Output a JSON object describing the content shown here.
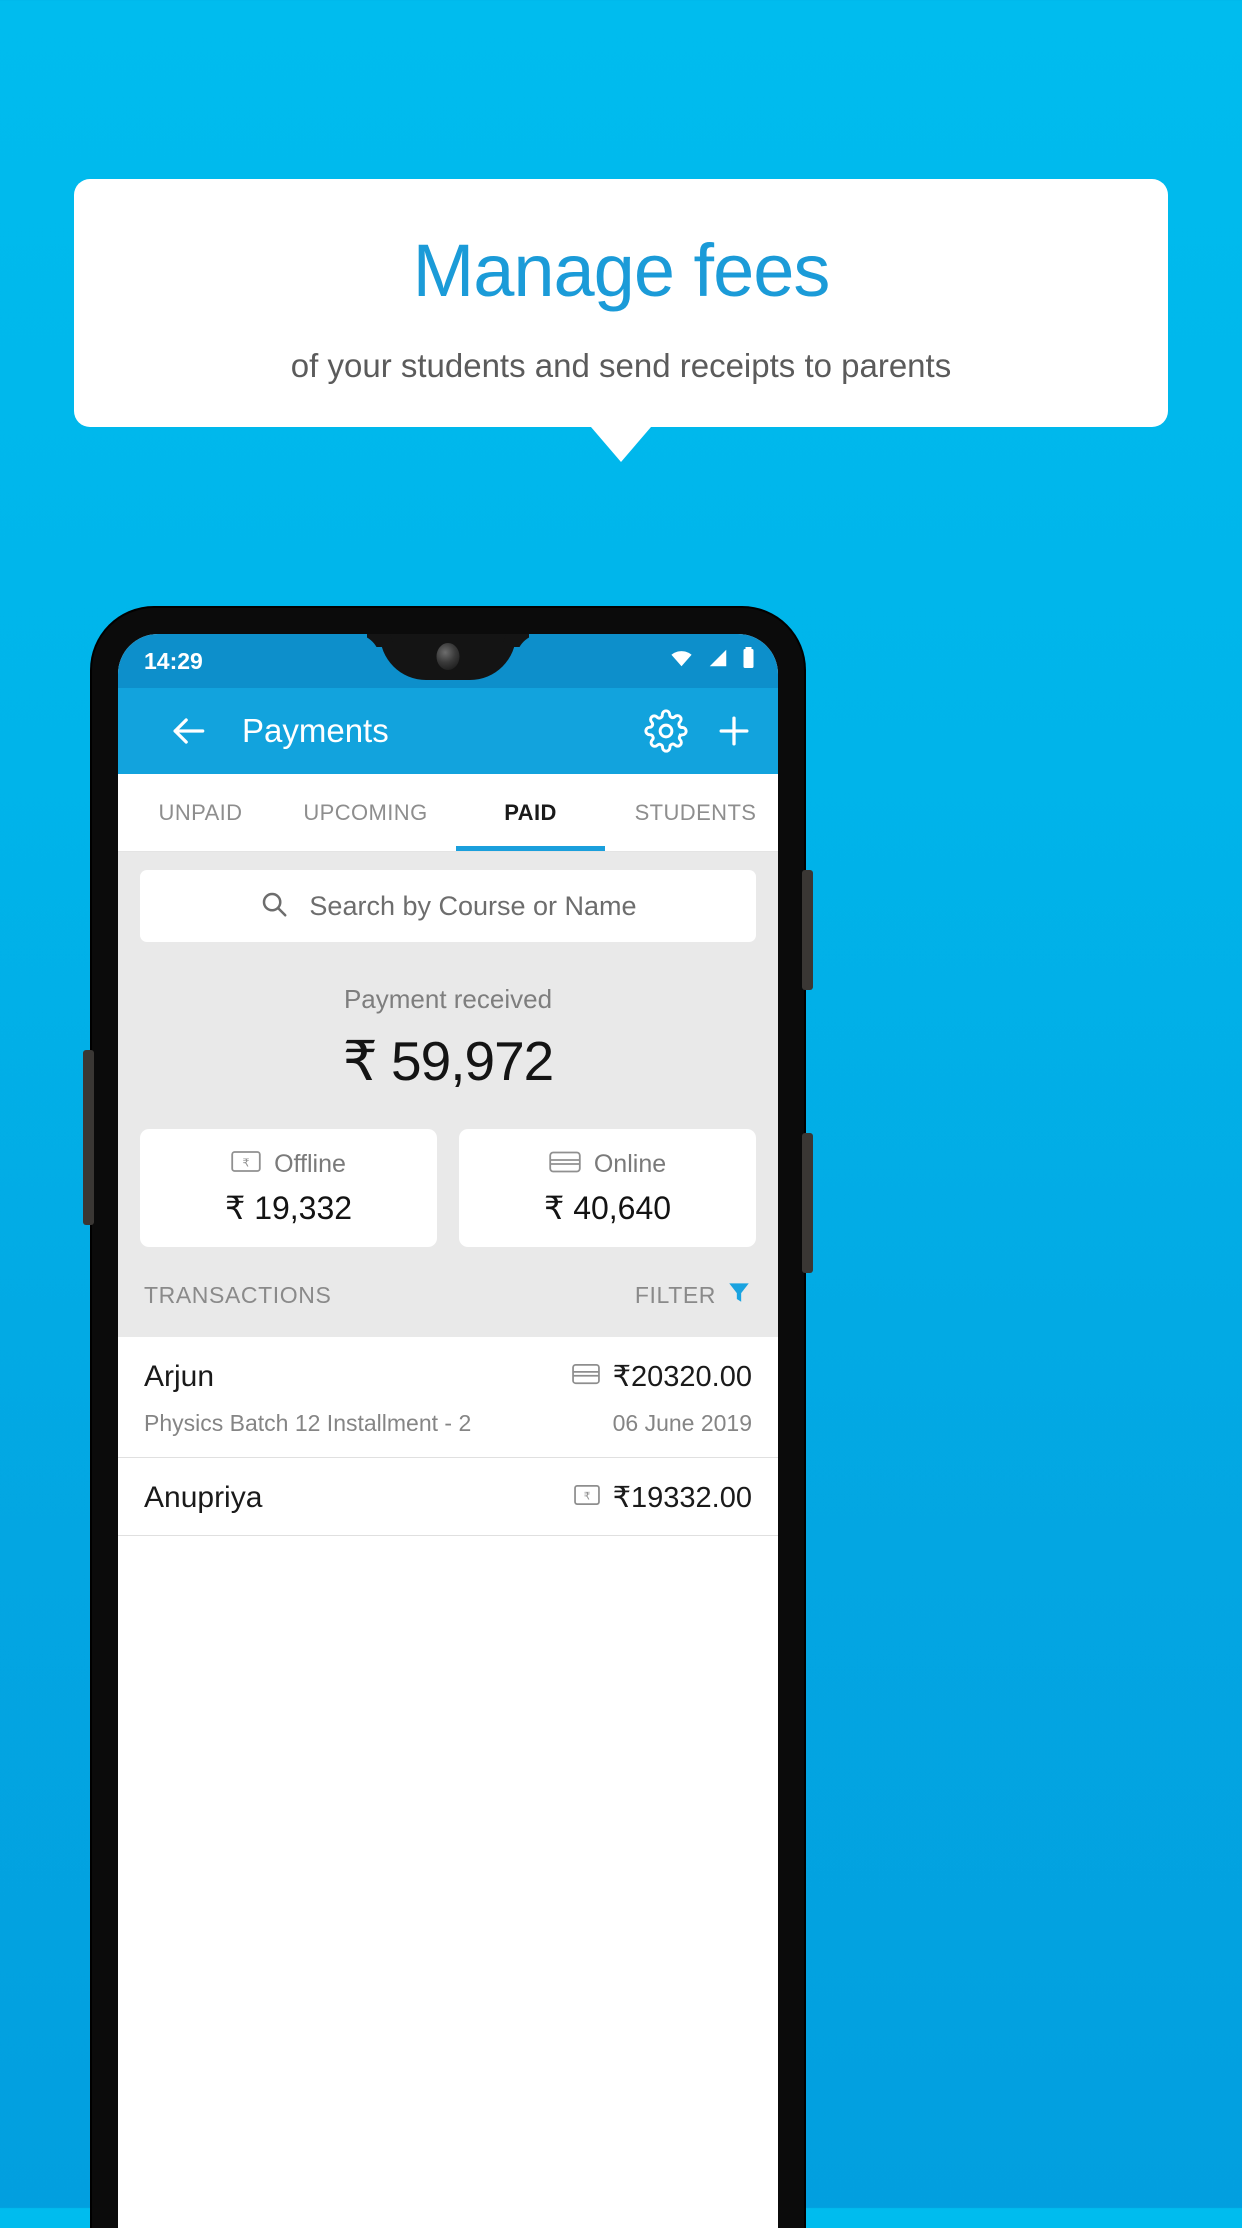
{
  "promo": {
    "title": "Manage fees",
    "subtitle": "of your students and send receipts to parents",
    "accent_color": "#1b9bd8",
    "background_color": "#00bcee"
  },
  "status_bar": {
    "time": "14:29",
    "icons": [
      "wifi-icon",
      "signal-icon",
      "battery-icon"
    ]
  },
  "app_bar": {
    "back_icon": "back-arrow-icon",
    "title": "Payments",
    "settings_icon": "gear-icon",
    "add_icon": "plus-icon"
  },
  "tabs": [
    {
      "label": "UNPAID",
      "active": false
    },
    {
      "label": "UPCOMING",
      "active": false
    },
    {
      "label": "PAID",
      "active": true
    },
    {
      "label": "STUDENTS",
      "active": false
    }
  ],
  "search": {
    "icon": "search-icon",
    "placeholder": "Search by Course or Name",
    "value": ""
  },
  "summary": {
    "label": "Payment received",
    "amount": "₹ 59,972"
  },
  "methods": [
    {
      "icon": "banknote-rupee-icon",
      "label": "Offline",
      "amount": "₹ 19,332"
    },
    {
      "icon": "credit-card-icon",
      "label": "Online",
      "amount": "₹ 40,640"
    }
  ],
  "transactions_header": {
    "title": "TRANSACTIONS",
    "filter_label": "FILTER",
    "filter_icon": "funnel-icon",
    "filter_color": "#1aa3e0"
  },
  "transactions": [
    {
      "name": "Arjun",
      "method_icon": "credit-card-icon",
      "amount": "₹20320.00",
      "description": "Physics Batch 12 Installment - 2",
      "date": "06 June 2019"
    },
    {
      "name": "Anupriya",
      "method_icon": "banknote-rupee-icon",
      "amount": "₹19332.00",
      "description": "",
      "date": ""
    }
  ]
}
